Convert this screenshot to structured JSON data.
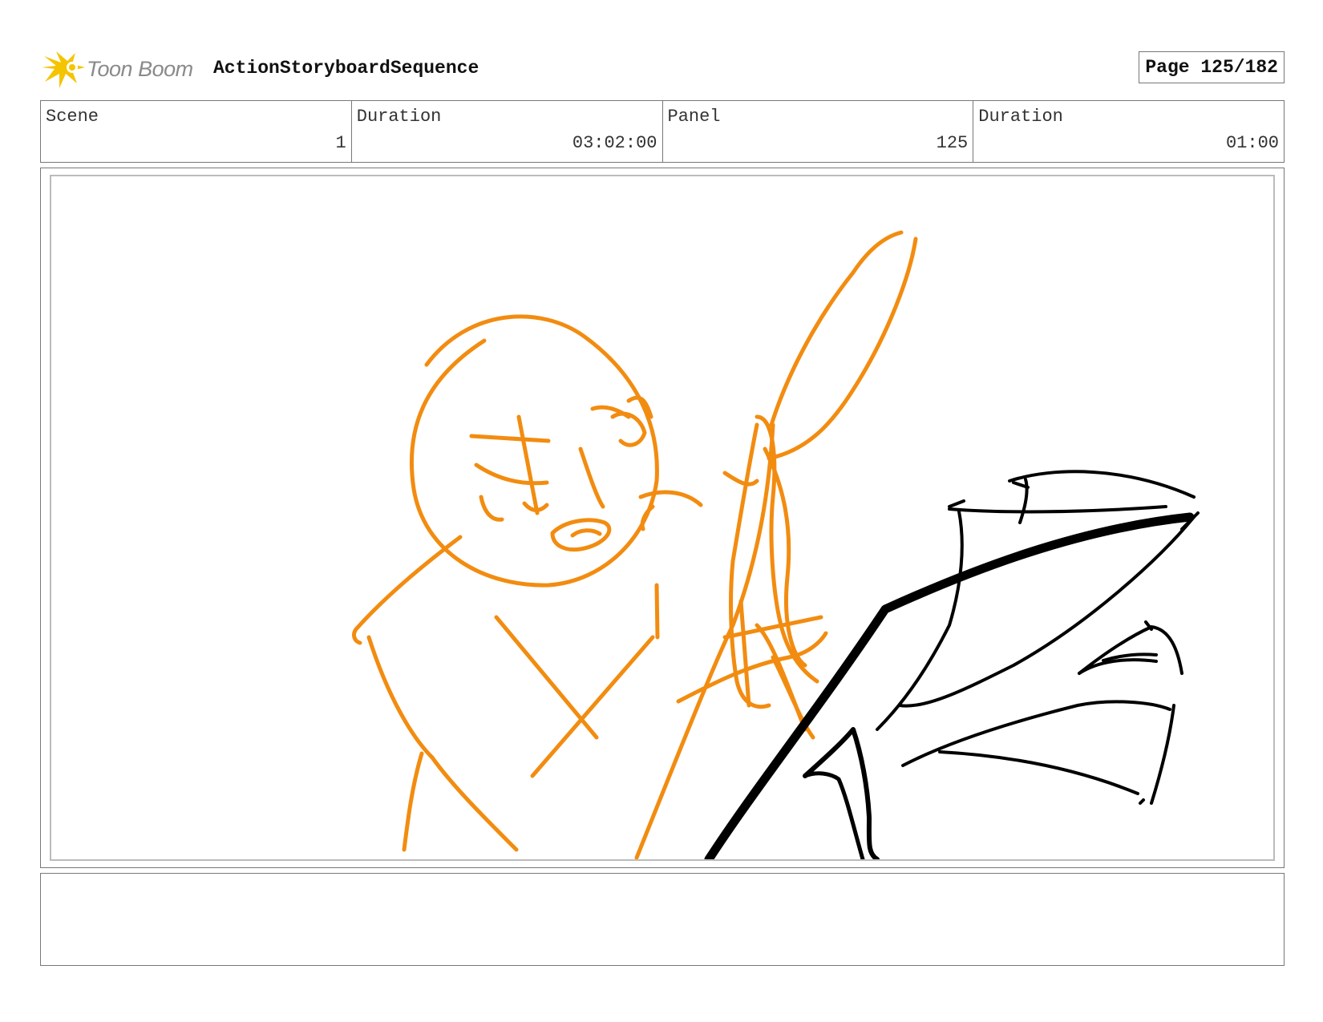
{
  "header": {
    "brand_name": "Toon Boom",
    "sequence_title": "ActionStoryboardSequence",
    "page_label": "Page 125/182"
  },
  "info": {
    "scene_label": "Scene",
    "scene_value": "1",
    "scene_duration_label": "Duration",
    "scene_duration_value": "03:02:00",
    "panel_label": "Panel",
    "panel_value": "125",
    "panel_duration_label": "Duration",
    "panel_duration_value": "01:00"
  },
  "colors": {
    "sketch_orange": "#F28C10",
    "sketch_black": "#000000",
    "logo_yellow": "#F5C400"
  },
  "icons": {
    "logo": "toon-boom-starburst-icon"
  },
  "notes": {
    "text": ""
  }
}
